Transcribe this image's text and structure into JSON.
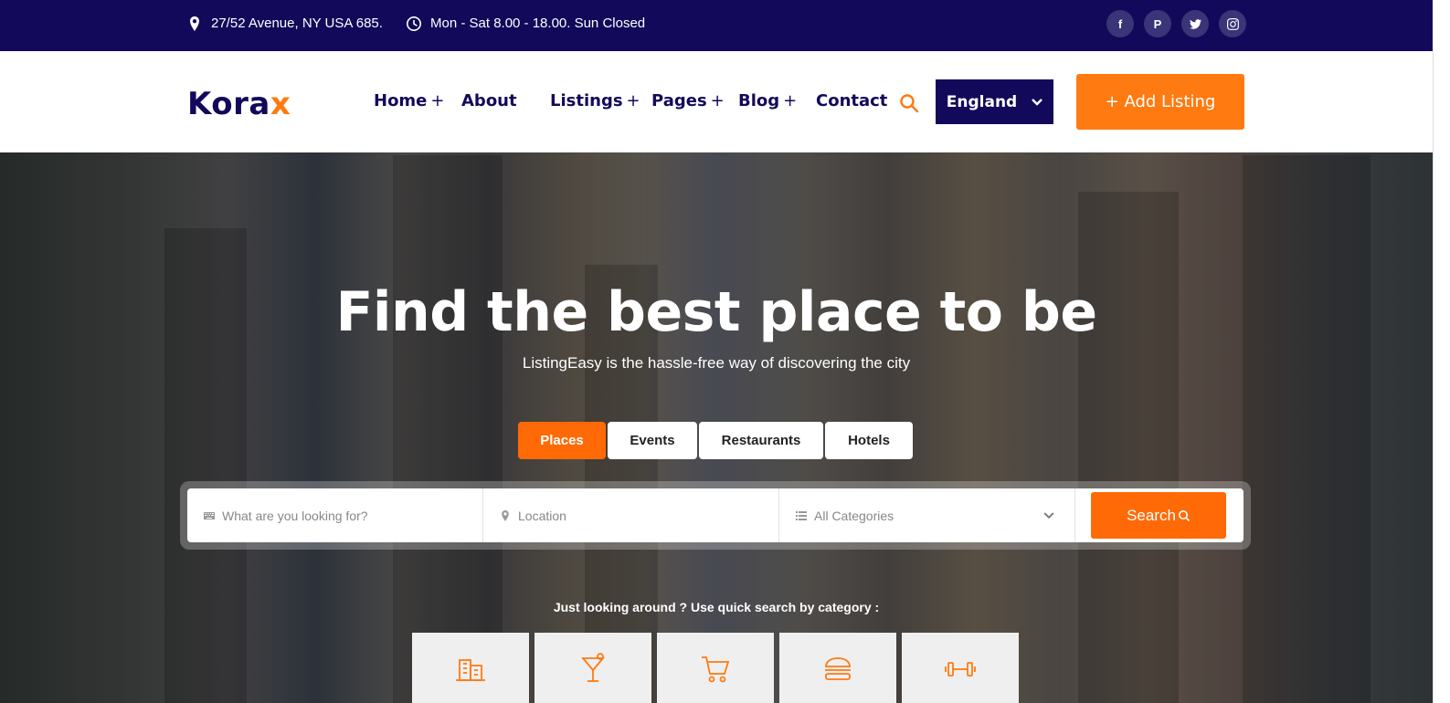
{
  "topbar": {
    "address": "27/52 Avenue, NY USA 685.",
    "hours": "Mon - Sat 8.00 - 18.00. Sun Closed",
    "socials": [
      "facebook-icon",
      "pinterest-icon",
      "twitter-icon",
      "instagram-icon"
    ]
  },
  "header": {
    "logo_main": "Kora",
    "logo_accent": "x",
    "nav": {
      "home": "Home",
      "about": "About",
      "listings": "Listings",
      "pages": "Pages",
      "blog": "Blog",
      "contact": "Contact",
      "plus": "+"
    },
    "language": "England",
    "add_listing": "+ Add Listing"
  },
  "hero": {
    "title": "Find the best place to be",
    "subtitle": "ListingEasy is the hassle-free way of discovering the city",
    "tabs": [
      "Places",
      "Events",
      "Restaurants",
      "Hotels"
    ],
    "active_tab": "Places"
  },
  "search": {
    "what_placeholder": "What are you looking for?",
    "location_placeholder": "Location",
    "category_selected": "All Categories",
    "button_label": "Search"
  },
  "quick": {
    "label": "Just looking around ? Use quick search by category :",
    "categories": [
      "hotel-building-icon",
      "cocktail-icon",
      "shopping-cart-icon",
      "burger-icon",
      "dumbbell-icon"
    ]
  },
  "colors": {
    "navy": "#13095a",
    "orange": "#ff7a10"
  }
}
